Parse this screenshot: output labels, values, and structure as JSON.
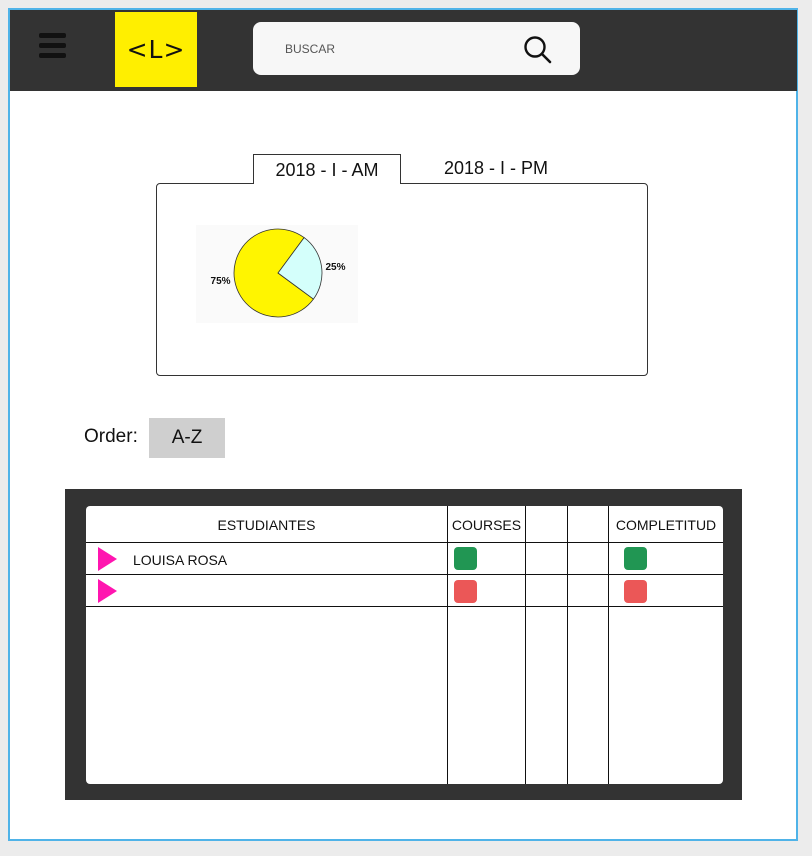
{
  "header": {
    "logo_text": "<L>",
    "search_placeholder": "BUSCAR",
    "search_icon": "magnifier-icon",
    "menu_icon": "hamburger-icon",
    "logo_color": "#ffef00",
    "bar_color": "#333333"
  },
  "tabs": [
    {
      "label": "2018 - I - AM",
      "active": true
    },
    {
      "label": "2018 - I - PM",
      "active": false
    }
  ],
  "chart_data": {
    "type": "pie",
    "slices": [
      {
        "label": "75%",
        "value": 75,
        "color": "#fff500"
      },
      {
        "label": "25%",
        "value": 25,
        "color": "#d4fffb"
      }
    ]
  },
  "order": {
    "label": "Order:",
    "value": "A-Z"
  },
  "table": {
    "columns": [
      "ESTUDIANTES",
      "COURSES",
      "",
      "",
      "COMPLETITUD"
    ],
    "rows": [
      {
        "name": "LOUISA ROSA",
        "courses_status": "#219653",
        "completitud_status": "#219653"
      },
      {
        "name": "",
        "courses_status": "#eb5757",
        "completitud_status": "#eb5757"
      }
    ]
  }
}
